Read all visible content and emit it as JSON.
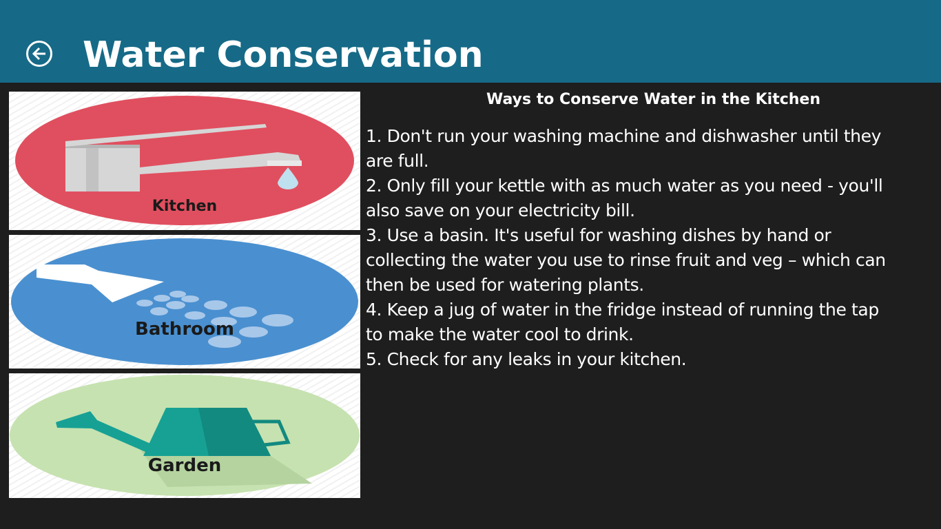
{
  "header": {
    "title": "Water Conservation",
    "back_icon": "back-arrow-icon",
    "background": "#166a87"
  },
  "tiles": [
    {
      "label": "Kitchen",
      "icon": "faucet-icon",
      "color": "#e04f5f"
    },
    {
      "label": "Bathroom",
      "icon": "shower-icon",
      "color": "#4a90d0"
    },
    {
      "label": "Garden",
      "icon": "watering-can-icon",
      "color": "#c6e2b0"
    }
  ],
  "content": {
    "heading": "Ways to Conserve Water in the Kitchen",
    "tips": [
      {
        "line1": "1. Don't run your washing machine and dishwasher until they",
        "line2": "are full."
      },
      {
        "line1": "2. Only fill your kettle with as much water as you need - you'll",
        "line2": "also save on your electricity bill."
      },
      {
        "line1": "3. Use a basin. It's useful for washing dishes by hand or",
        "line2": "collecting the water you use to rinse fruit and veg – which can",
        "line3": "then be used for watering plants."
      },
      {
        "line1": "4. Keep a jug of water in the fridge instead of running the tap",
        "line2": "to make the water cool to drink."
      },
      {
        "line1": "5. Check for any leaks in your kitchen."
      }
    ]
  }
}
